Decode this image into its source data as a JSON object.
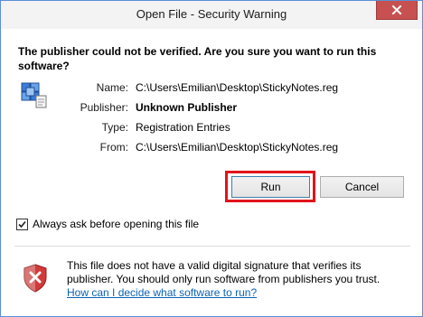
{
  "window": {
    "title": "Open File - Security Warning",
    "close_symbol": "✕"
  },
  "headline": "The publisher could not be verified.  Are you sure you want to run this software?",
  "details": [
    {
      "label": "Name:",
      "value": "C:\\Users\\Emilian\\Desktop\\StickyNotes.reg",
      "bold": false
    },
    {
      "label": "Publisher:",
      "value": "Unknown Publisher",
      "bold": true
    },
    {
      "label": "Type:",
      "value": "Registration Entries",
      "bold": false
    },
    {
      "label": "From:",
      "value": "C:\\Users\\Emilian\\Desktop\\StickyNotes.reg",
      "bold": false
    }
  ],
  "buttons": {
    "run": "Run",
    "cancel": "Cancel"
  },
  "checkbox": {
    "label": "Always ask before opening this file",
    "checked": true
  },
  "footer": {
    "warning_text": "This file does not have a valid digital signature that verifies its publisher.  You should only run software from publishers you trust.",
    "help_link": "How can I decide what software to run?"
  },
  "icons": {
    "file": "registry-file-icon",
    "shield": "shield-error-icon",
    "close": "close-icon",
    "check": "checkmark-icon"
  },
  "colors": {
    "highlight": "#e0141b",
    "link": "#0a64b4",
    "close_button": "#c75050"
  }
}
